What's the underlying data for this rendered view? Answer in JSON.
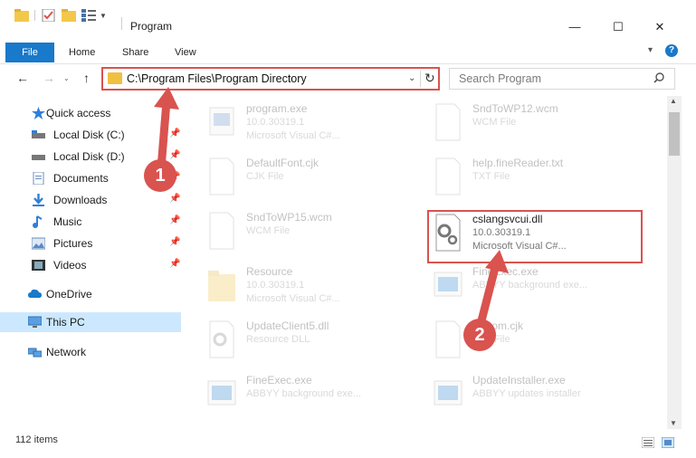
{
  "window": {
    "title": "Program",
    "minimize": "—",
    "maximize": "☐",
    "close": "✕"
  },
  "ribbon": {
    "tabs": [
      "File",
      "Home",
      "Share",
      "View"
    ],
    "help": "?"
  },
  "nav": {
    "back": "←",
    "forward": "→",
    "up": "↑",
    "address": "C:\\Program Files\\Program Directory",
    "refresh": "↻",
    "search_placeholder": "Search Program"
  },
  "sidebar": {
    "items": [
      {
        "label": "Quick access",
        "icon": "star-icon"
      },
      {
        "label": "Local Disk (C:)",
        "icon": "drive-icon"
      },
      {
        "label": "Local Disk (D:)",
        "icon": "drive-icon"
      },
      {
        "label": "Documents",
        "icon": "documents-icon"
      },
      {
        "label": "Downloads",
        "icon": "download-icon"
      },
      {
        "label": "Music",
        "icon": "music-icon"
      },
      {
        "label": "Pictures",
        "icon": "pictures-icon"
      },
      {
        "label": "Videos",
        "icon": "videos-icon"
      },
      {
        "label": "OneDrive",
        "icon": "cloud-icon"
      },
      {
        "label": "This PC",
        "icon": "computer-icon"
      },
      {
        "label": "Network",
        "icon": "network-icon"
      }
    ]
  },
  "files": [
    {
      "name": "program.exe",
      "line1": "10.0.30319.1",
      "line2": "Microsoft Visual C#..."
    },
    {
      "name": "SndToWP12.wcm",
      "line1": "WCM File",
      "line2": ""
    },
    {
      "name": "DefaultFont.cjk",
      "line1": "CJK File",
      "line2": ""
    },
    {
      "name": "help.fineReader.txt",
      "line1": "TXT File",
      "line2": ""
    },
    {
      "name": "SndToWP15.wcm",
      "line1": "WCM File",
      "line2": ""
    },
    {
      "name": "cslangsvcui.dll",
      "line1": "10.0.30319.1",
      "line2": "Microsoft Visual C#..."
    },
    {
      "name": "Resource",
      "line1": "10.0.30319.1",
      "line2": "Microsoft Visual C#..."
    },
    {
      "name": "FineExec.exe",
      "line1": "ABBYY background exe...",
      "line2": ""
    },
    {
      "name": "UpdateClient5.dll",
      "line1": "Resource DLL",
      "line2": ""
    },
    {
      "name": "Bottom.cjk",
      "line1": "CJK File",
      "line2": ""
    },
    {
      "name": "FineExec.exe",
      "line1": "ABBYY background exe...",
      "line2": ""
    },
    {
      "name": "UpdateInstaller.exe",
      "line1": "ABBYY updates installer",
      "line2": ""
    }
  ],
  "status": {
    "count": "112 items"
  },
  "callouts": [
    "1",
    "2"
  ],
  "colors": {
    "accent": "#1979ca",
    "highlight": "#d9534f",
    "selected": "#cce8ff"
  }
}
